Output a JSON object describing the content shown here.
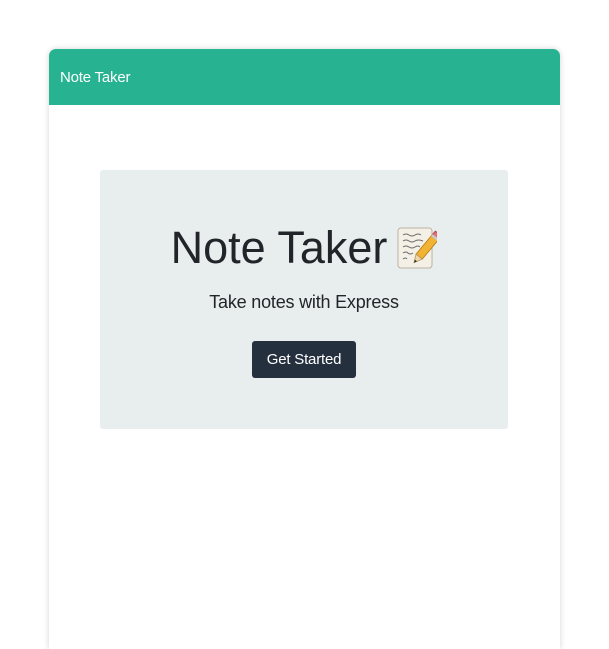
{
  "navbar": {
    "brand": "Note Taker"
  },
  "hero": {
    "title": "Note Taker",
    "title_icon": "memo-icon",
    "subtitle": "Take notes with Express",
    "button_label": "Get Started"
  },
  "colors": {
    "navbar_bg": "#27b391",
    "jumbotron_bg": "#e8edee",
    "button_bg": "#25303f",
    "text": "#212529"
  }
}
